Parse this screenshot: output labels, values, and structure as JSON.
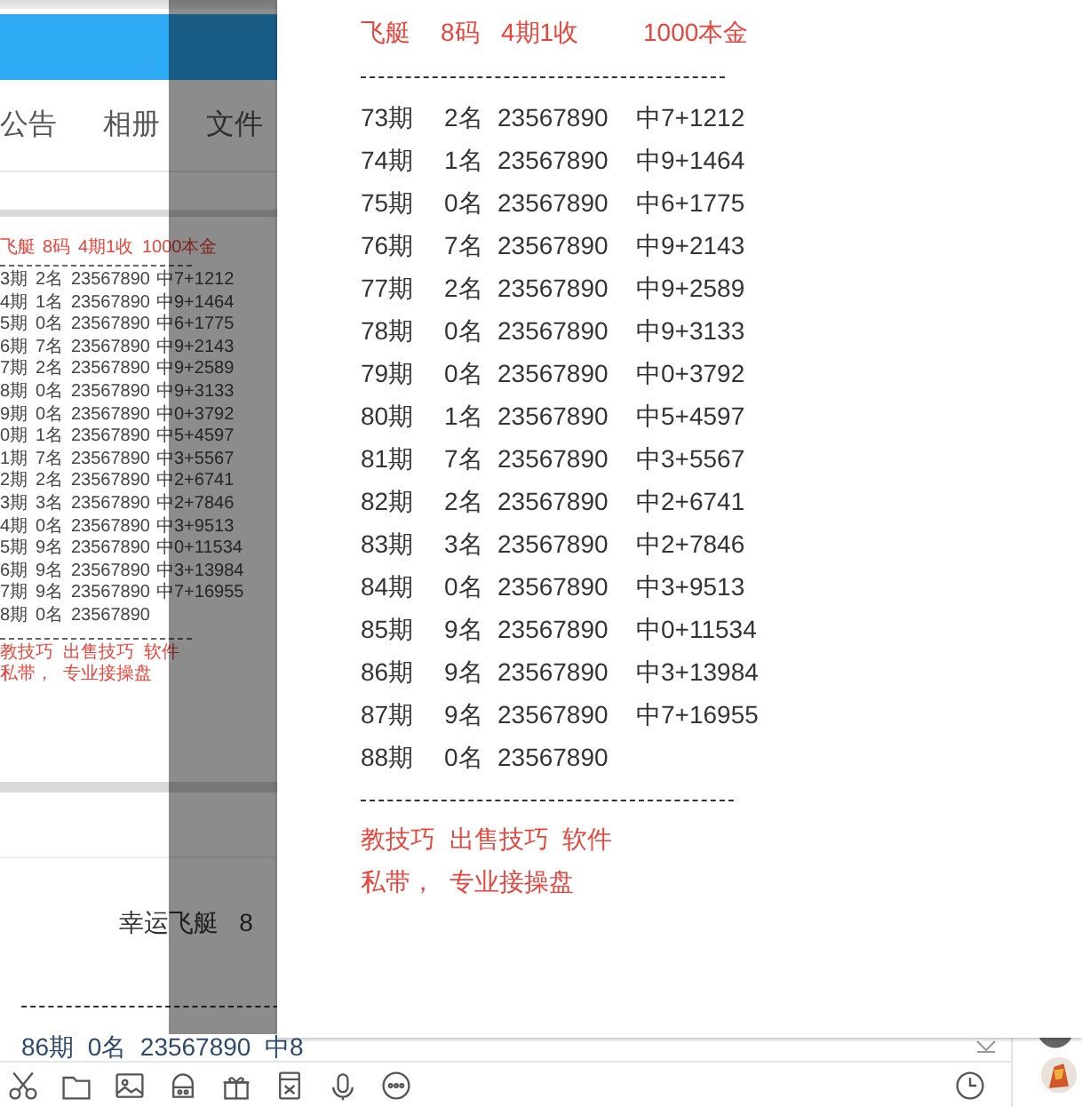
{
  "chat_window": {
    "tabs": [
      {
        "label": "公告"
      },
      {
        "label": "相册"
      },
      {
        "label": "文件"
      }
    ],
    "shared_image": {
      "header": [
        "飞艇",
        "8码",
        "4期1收",
        "1000本金"
      ],
      "rows": [
        {
          "period": "3期",
          "rank": "2名",
          "numbers": "23567890",
          "result": "中7+1212"
        },
        {
          "period": "4期",
          "rank": "1名",
          "numbers": "23567890",
          "result": "中9+1464"
        },
        {
          "period": "5期",
          "rank": "0名",
          "numbers": "23567890",
          "result": "中6+1775"
        },
        {
          "period": "6期",
          "rank": "7名",
          "numbers": "23567890",
          "result": "中9+2143"
        },
        {
          "period": "7期",
          "rank": "2名",
          "numbers": "23567890",
          "result": "中9+2589"
        },
        {
          "period": "8期",
          "rank": "0名",
          "numbers": "23567890",
          "result": "中9+3133"
        },
        {
          "period": "9期",
          "rank": "0名",
          "numbers": "23567890",
          "result": "中0+3792"
        },
        {
          "period": "0期",
          "rank": "1名",
          "numbers": "23567890",
          "result": "中5+4597"
        },
        {
          "period": "1期",
          "rank": "7名",
          "numbers": "23567890",
          "result": "中3+5567"
        },
        {
          "period": "2期",
          "rank": "2名",
          "numbers": "23567890",
          "result": "中2+6741"
        },
        {
          "period": "3期",
          "rank": "3名",
          "numbers": "23567890",
          "result": "中2+7846"
        },
        {
          "period": "4期",
          "rank": "0名",
          "numbers": "23567890",
          "result": "中3+9513"
        },
        {
          "period": "5期",
          "rank": "9名",
          "numbers": "23567890",
          "result": "中0+11534"
        },
        {
          "period": "6期",
          "rank": "9名",
          "numbers": "23567890",
          "result": "中3+13984"
        },
        {
          "period": "7期",
          "rank": "9名",
          "numbers": "23567890",
          "result": "中7+16955"
        },
        {
          "period": "8期",
          "rank": "0名",
          "numbers": "23567890"
        }
      ],
      "footer": [
        "教技巧  出售技巧  软件",
        "私带，  专业接操盘"
      ]
    },
    "message": "幸运飞艇   8",
    "input_preview": "86期  0名  23567890  中8"
  },
  "image_viewer": {
    "header": [
      "飞艇",
      "8码",
      "4期1收",
      "1000本金"
    ],
    "rows": [
      {
        "period": "73期",
        "rank": "2名",
        "numbers": "23567890",
        "result": "中7+1212"
      },
      {
        "period": "74期",
        "rank": "1名",
        "numbers": "23567890",
        "result": "中9+1464"
      },
      {
        "period": "75期",
        "rank": "0名",
        "numbers": "23567890",
        "result": "中6+1775"
      },
      {
        "period": "76期",
        "rank": "7名",
        "numbers": "23567890",
        "result": "中9+2143"
      },
      {
        "period": "77期",
        "rank": "2名",
        "numbers": "23567890",
        "result": "中9+2589"
      },
      {
        "period": "78期",
        "rank": "0名",
        "numbers": "23567890",
        "result": "中9+3133"
      },
      {
        "period": "79期",
        "rank": "0名",
        "numbers": "23567890",
        "result": "中0+3792"
      },
      {
        "period": "80期",
        "rank": "1名",
        "numbers": "23567890",
        "result": "中5+4597"
      },
      {
        "period": "81期",
        "rank": "7名",
        "numbers": "23567890",
        "result": "中3+5567"
      },
      {
        "period": "82期",
        "rank": "2名",
        "numbers": "23567890",
        "result": "中2+6741"
      },
      {
        "period": "83期",
        "rank": "3名",
        "numbers": "23567890",
        "result": "中2+7846"
      },
      {
        "period": "84期",
        "rank": "0名",
        "numbers": "23567890",
        "result": "中3+9513"
      },
      {
        "period": "85期",
        "rank": "9名",
        "numbers": "23567890",
        "result": "中0+11534"
      },
      {
        "period": "86期",
        "rank": "9名",
        "numbers": "23567890",
        "result": "中3+13984"
      },
      {
        "period": "87期",
        "rank": "9名",
        "numbers": "23567890",
        "result": "中7+16955"
      },
      {
        "period": "88期",
        "rank": "0名",
        "numbers": "23567890"
      }
    ],
    "footer": [
      "教技巧  出售技巧  软件",
      "私带，  专业接操盘"
    ]
  }
}
